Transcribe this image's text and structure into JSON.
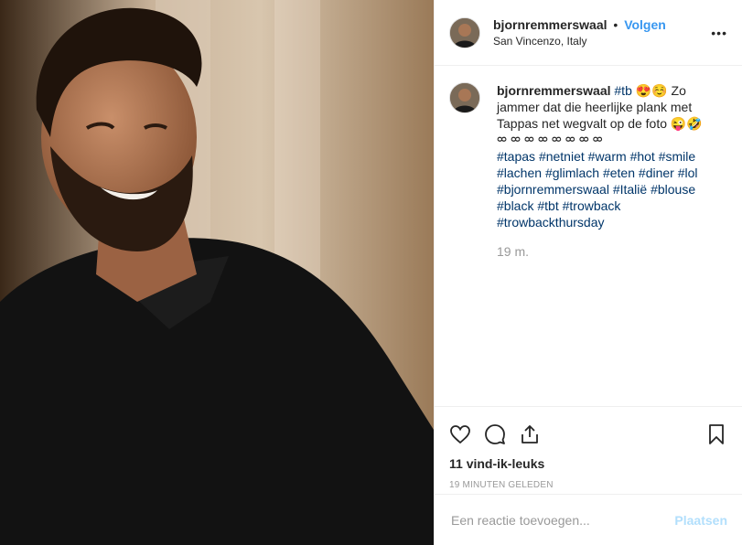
{
  "header": {
    "username": "bjornremmerswaal",
    "separator": "•",
    "follow_label": "Volgen",
    "location": "San Vincenzo, Italy",
    "more_label": "•••"
  },
  "caption": {
    "username": "bjornremmerswaal",
    "tag_tb": "#tb",
    "emoji1": "😍☺️",
    "text": "Zo jammer dat die heerlijke plank met Tappas net wegvalt op de foto",
    "emoji2": "😜🤣",
    "decor": "ᢁ ᢁ ᢁ ᢁ ᢁ ᢁ ᢁ ᢁ",
    "hashtags": [
      "#tapas",
      "#netniet",
      "#warm",
      "#hot",
      "#smile",
      "#lachen",
      "#glimlach",
      "#eten",
      "#diner",
      "#lol",
      "#bjornremmerswaal",
      "#Italië",
      "#blouse",
      "#black",
      "#tbt",
      "#trowback",
      "#trowbackthursday"
    ],
    "time": "19 m."
  },
  "actions": {
    "like_icon": "heart-icon",
    "comment_icon": "comment-icon",
    "share_icon": "share-icon",
    "save_icon": "bookmark-icon",
    "likes": "11 vind-ik-leuks",
    "posted_ago": "19 MINUTEN GELEDEN"
  },
  "comment_box": {
    "placeholder": "Een reactie toevoegen...",
    "post_label": "Plaatsen"
  },
  "colors": {
    "link": "#3897f0",
    "hashtag": "#003569",
    "post_disabled": "#b2dffc",
    "muted": "#999999"
  }
}
